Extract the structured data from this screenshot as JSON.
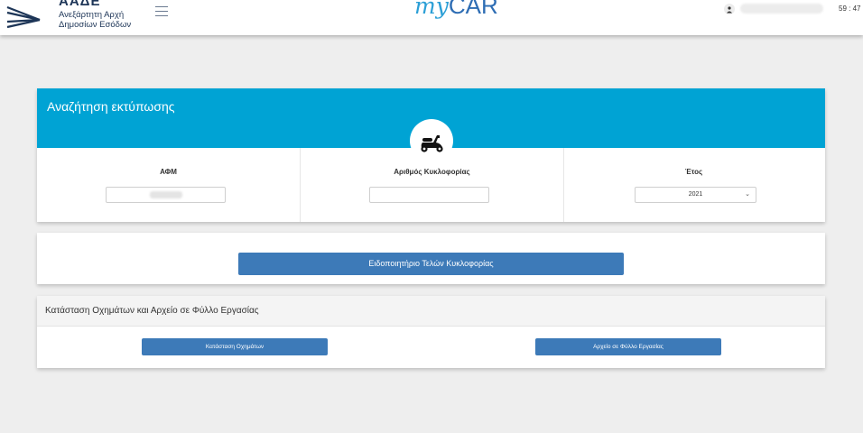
{
  "header": {
    "org_short": "ΑΑΔΕ",
    "org_line1": "Ανεξάρτητη Αρχή",
    "org_line2": "Δημοσίων Εσόδων",
    "brand_my": "my",
    "brand_car": "CAR",
    "timer": "59 : 47"
  },
  "search": {
    "title": "Αναζήτηση εκτύπωσης",
    "vehicle_icon": "scooter-icon",
    "afm_label": "ΑΦΜ",
    "afm_value": "",
    "plate_label": "Αριθμός Κυκλοφορίας",
    "plate_value": "",
    "year_label": "Έτος",
    "year_value": "2021"
  },
  "notice": {
    "button_label": "Ειδοποιητήριο Τελών Κυκλοφορίας"
  },
  "status": {
    "title": "Κατάσταση Οχημάτων και Αρχείο σε Φύλλο Εργασίας",
    "vehicles_button": "Κατάσταση Οχημάτων",
    "spreadsheet_button": "Αρχείο σε Φύλλο Εργασίας"
  },
  "colors": {
    "accent": "#00a3d4",
    "button": "#3d7ab8",
    "brand": "#2e6db4"
  }
}
